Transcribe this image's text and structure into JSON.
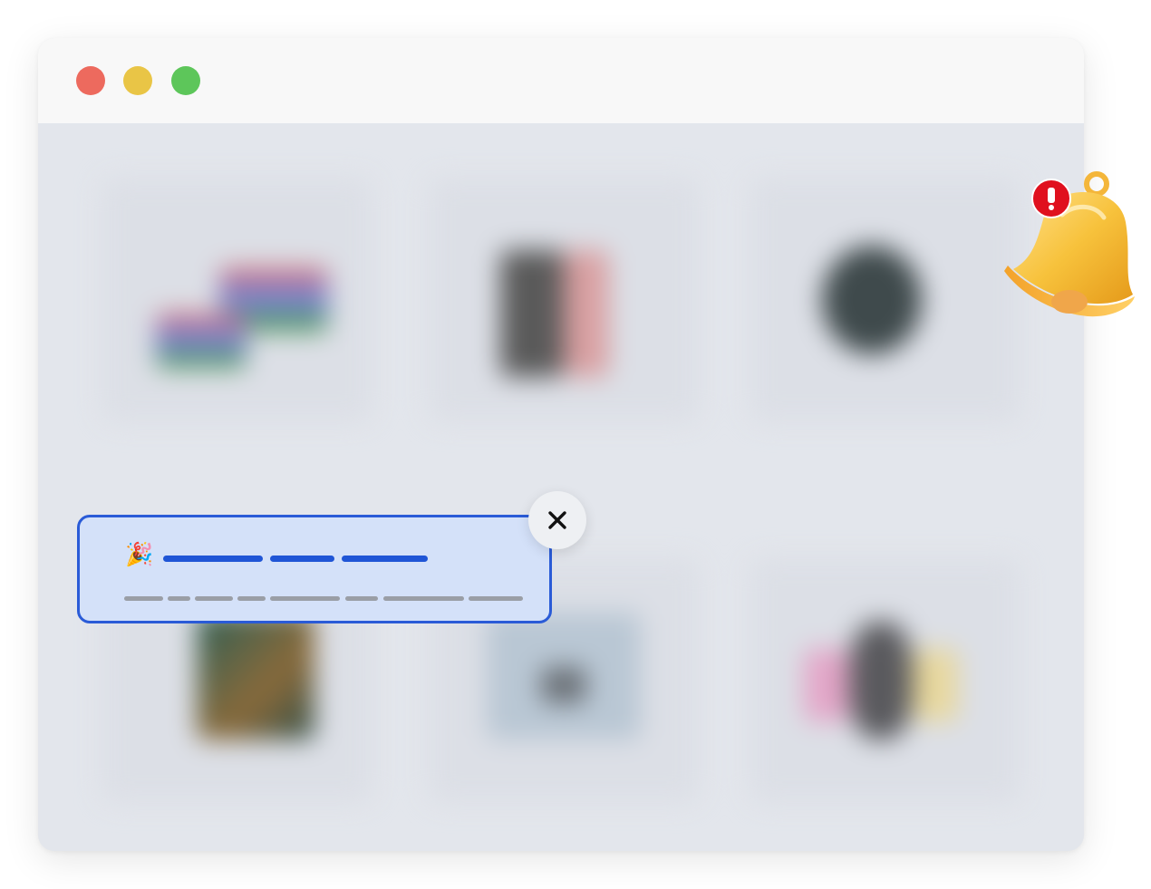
{
  "window": {
    "traffic_lights": {
      "close_color": "#ed6a5e",
      "minimize_color": "#e9c546",
      "maximize_color": "#5dc65a"
    }
  },
  "notification": {
    "emoji": "🎉",
    "accent_color": "#2a5bd7",
    "background_color": "#d4e1f9"
  },
  "close_button": {
    "symbol": "✕"
  },
  "bell": {
    "badge_symbol": "!",
    "badge_color": "#e0101e"
  },
  "icons": [
    "party-popper-icon",
    "close-icon",
    "bell-icon"
  ]
}
